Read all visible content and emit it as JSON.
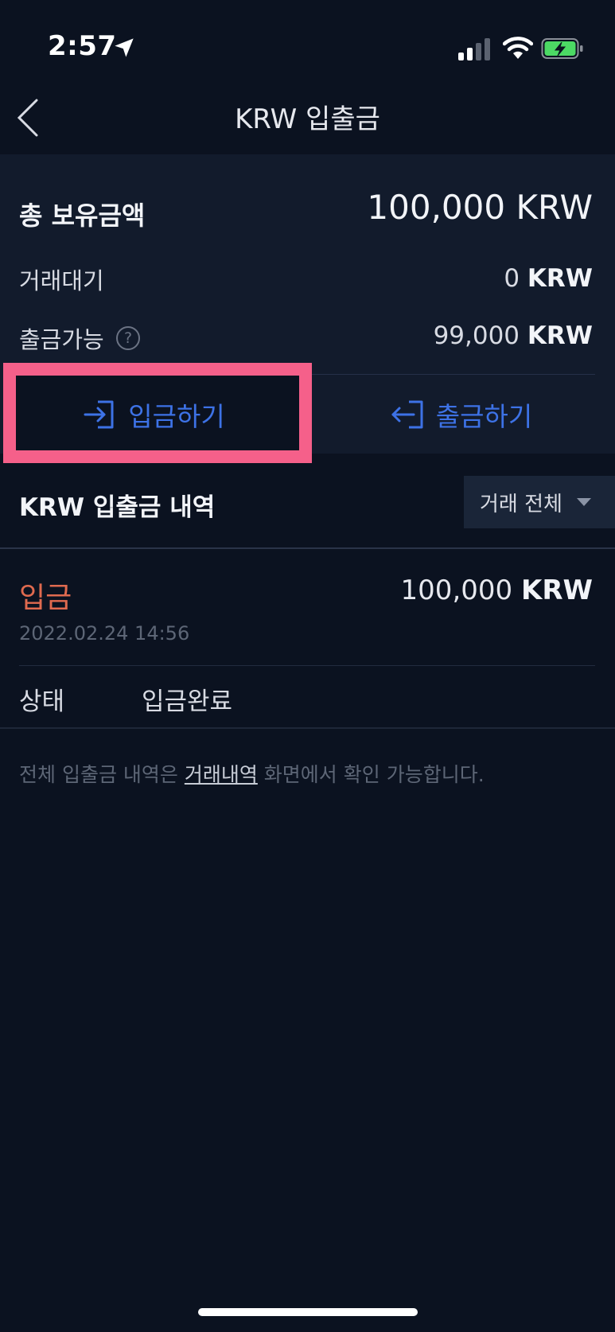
{
  "status_bar": {
    "time": "2:57"
  },
  "header": {
    "title": "KRW 입출금"
  },
  "balance": {
    "total_label": "총 보유금액",
    "total_value": "100,000 KRW",
    "pending_label": "거래대기",
    "pending_amount": "0",
    "pending_unit": "KRW",
    "available_label": "출금가능",
    "available_amount": "99,000",
    "available_unit": "KRW",
    "help_glyph": "?"
  },
  "actions": {
    "deposit_label": "입금하기",
    "withdraw_label": "출금하기"
  },
  "history": {
    "title": "KRW 입출금 내역",
    "filter_label": "거래 전체",
    "items": [
      {
        "type": "입금",
        "amount": "100,000",
        "unit": "KRW",
        "datetime": "2022.02.24 14:56",
        "status_label": "상태",
        "status_value": "입금완료"
      }
    ],
    "note_before": "전체 입출금 내역은 ",
    "note_link": "거래내역",
    "note_after": " 화면에서 확인 가능합니다."
  },
  "colors": {
    "background": "#0b1220",
    "panel": "#121b2c",
    "accent_blue": "#3d72e6",
    "deposit_red": "#e06a4f",
    "highlight_pink": "#f5608a",
    "battery_green": "#4cd964"
  },
  "icons": [
    "location-arrow-icon",
    "signal-icon",
    "wifi-icon",
    "battery-charging-icon",
    "back-chevron-icon",
    "deposit-icon",
    "withdraw-icon",
    "help-icon",
    "caret-down-icon"
  ]
}
